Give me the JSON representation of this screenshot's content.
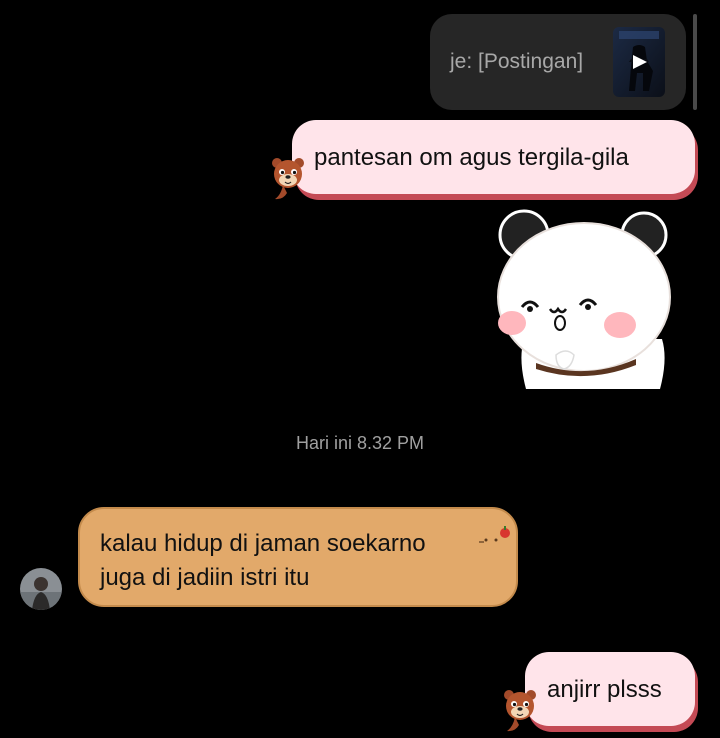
{
  "reply_preview": {
    "text": "je: [Postingan]",
    "thumbnail_icon": "video-play-icon"
  },
  "messages": {
    "sent_1": "pantesan om agus tergila-gila",
    "sticker_icon": "panda-bear-sticker",
    "timestamp": "Hari ini 8.32 PM",
    "received_1_line1": "kalau hidup di jaman soekarno",
    "received_1_line2": "juga di jadiin istri itu",
    "sent_2": "anjirr plsss"
  },
  "colors": {
    "background": "#000000",
    "sent_bubble": "#ffe4ea",
    "sent_bubble_shadow": "#c44a55",
    "received_bubble": "#e2a96a",
    "reply_card": "#262626",
    "timestamp_text": "#a0a0a0"
  }
}
